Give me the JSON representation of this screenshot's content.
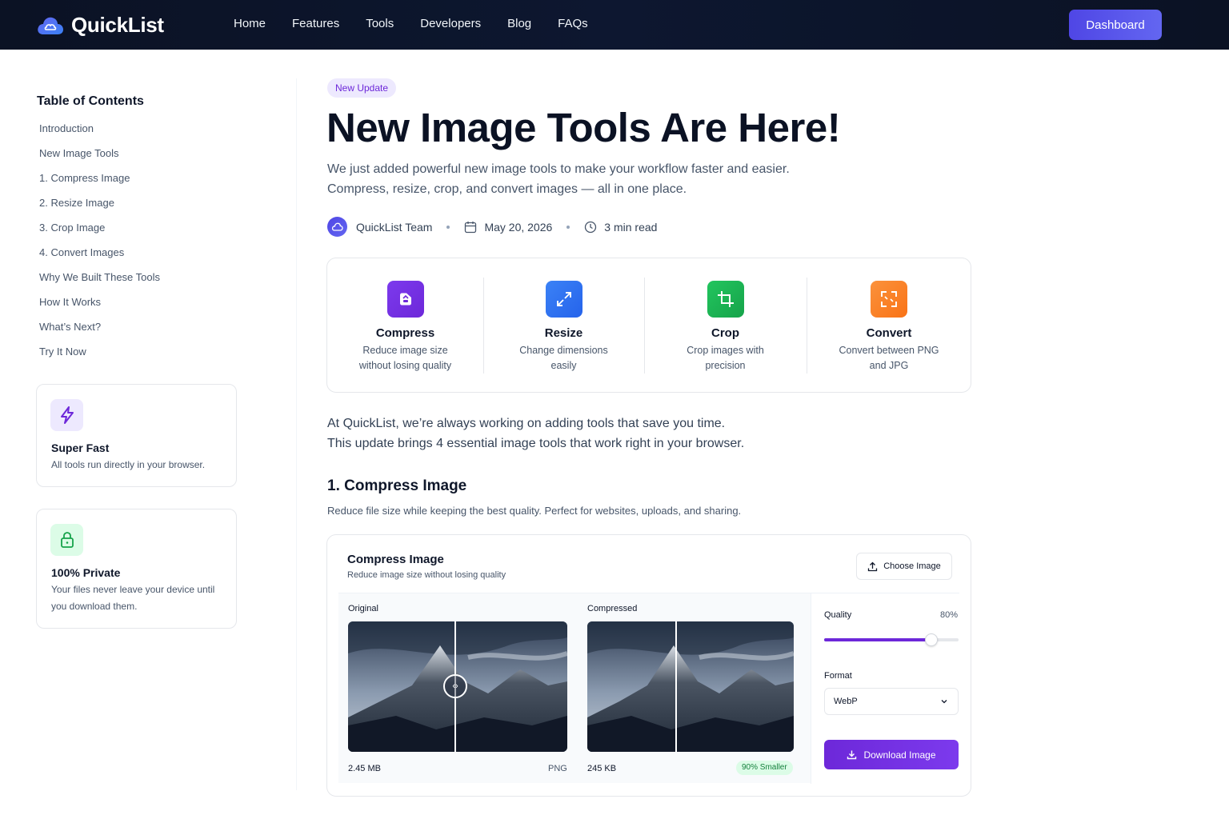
{
  "nav": {
    "brand": "QuickList",
    "links": [
      "Home",
      "Features",
      "Tools",
      "Developers",
      "Blog",
      "FAQs"
    ],
    "dashboard_label": "Dashboard"
  },
  "sidebar": {
    "toc_title": "Table of Contents",
    "toc_items": [
      "Introduction",
      "New Image Tools",
      "1. Compress Image",
      "2. Resize Image",
      "3. Crop Image",
      "4. Convert Images",
      "Why We Built These Tools",
      "How It Works",
      "What’s Next?",
      "Try It Now"
    ],
    "cards": [
      {
        "title": "Super Fast",
        "desc": "All tools run directly in your browser.",
        "icon": "lightning-icon"
      },
      {
        "title": "100% Private",
        "desc": "Your files never leave your device until you download them.",
        "icon": "lock-icon"
      }
    ]
  },
  "article": {
    "badge": "New Update",
    "title": "New Image Tools Are Here!",
    "lead_1": "We just added powerful new image tools to make your workflow faster and easier.",
    "lead_2": "Compress, resize, crop, and convert images — all in one place.",
    "author": "QuickList Team",
    "date": "May 20, 2026",
    "read_time": "3 min read",
    "tools": [
      {
        "name": "Compress",
        "desc_1": "Reduce image size",
        "desc_2": "without losing quality",
        "icon": "compress-icon",
        "color": "#6d28d9"
      },
      {
        "name": "Resize",
        "desc_1": "Change dimensions",
        "desc_2": "easily",
        "icon": "resize-icon",
        "color": "#2563eb"
      },
      {
        "name": "Crop",
        "desc_1": "Crop images with",
        "desc_2": "precision",
        "icon": "crop-icon",
        "color": "#16a34a"
      },
      {
        "name": "Convert",
        "desc_1": "Convert between PNG",
        "desc_2": "and JPG",
        "icon": "convert-icon",
        "color": "#f97316"
      }
    ],
    "para_1": "At QuickList, we’re always working on adding tools that save you time.",
    "para_2": "This update brings 4 essential image tools that work right in your browser.",
    "section_title": "1. Compress Image",
    "section_sub": "Reduce file size while keeping the best quality. Perfect for websites, uploads, and sharing."
  },
  "demo": {
    "title": "Compress Image",
    "subtitle": "Reduce image size without losing quality",
    "choose_label": "Choose Image",
    "original_label": "Original",
    "compressed_label": "Compressed",
    "original_size": "2.45 MB",
    "original_format": "PNG",
    "compressed_size": "245 KB",
    "savings_badge": "90% Smaller",
    "quality_label": "Quality",
    "quality_value": "80%",
    "quality_level": 0.8,
    "format_label": "Format",
    "format_selected": "WebP",
    "download_label": "Download Image"
  }
}
